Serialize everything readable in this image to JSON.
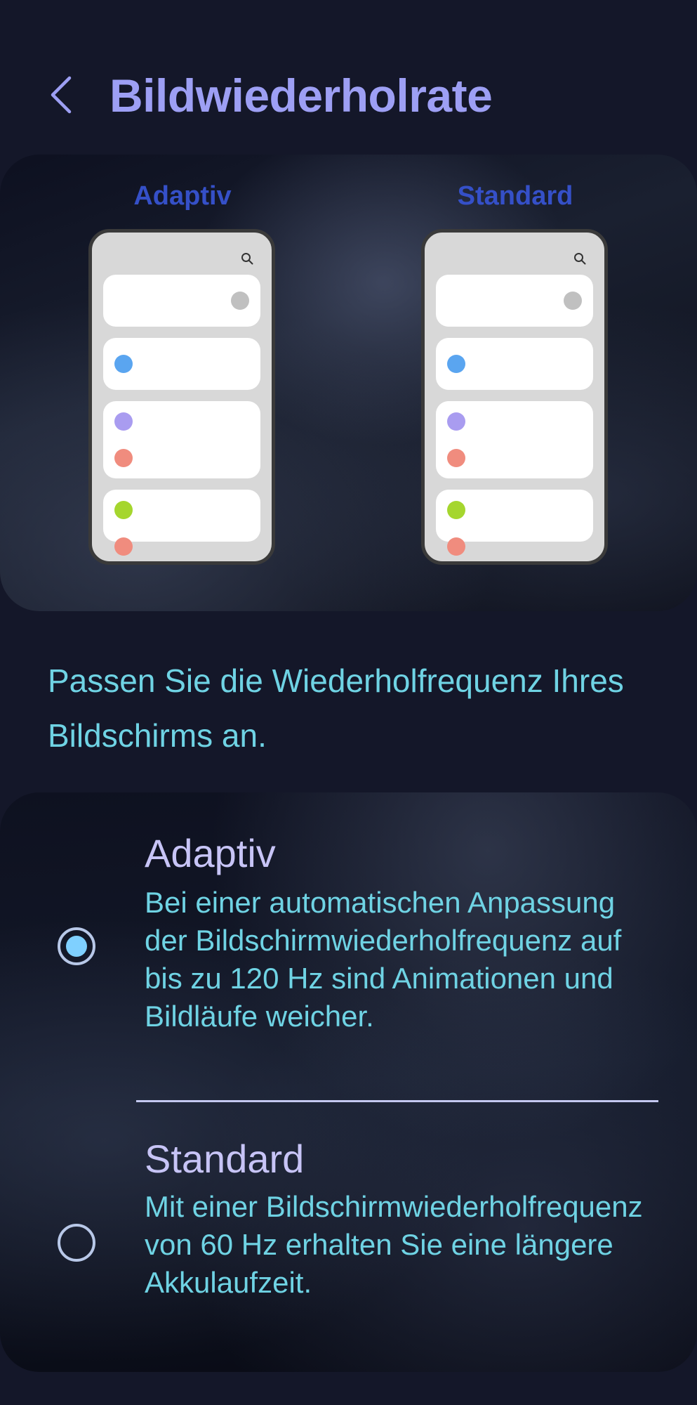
{
  "header": {
    "title": "Bildwiederholrate",
    "back_icon": "chevron-left-icon"
  },
  "preview": {
    "modes": [
      {
        "label": "Adaptiv"
      },
      {
        "label": "Standard"
      }
    ],
    "dot_colors": {
      "gray": "#c0c0c0",
      "blue": "#5aa5f0",
      "purple": "#a99cf0",
      "salmon": "#f08c7e",
      "green": "#a5d62e"
    }
  },
  "subtitle": "Passen Sie die Wiederholfrequenz Ihres Bildschirms an.",
  "options": [
    {
      "title": "Adaptiv",
      "description": "Bei einer automatischen Anpassung der Bildschirmwiederholfrequenz auf bis zu 120 Hz sind Animationen und Bildläufe weicher.",
      "selected": true
    },
    {
      "title": "Standard",
      "description": "Mit einer Bildschirmwiederholfrequenz von 60 Hz erhalten Sie eine längere Akkulaufzeit.",
      "selected": false
    }
  ],
  "colors": {
    "title": "#9d9ff4",
    "accent_text": "#6fd3e4",
    "mode_label": "#3550c8",
    "radio_on": "#7fd0ff"
  }
}
